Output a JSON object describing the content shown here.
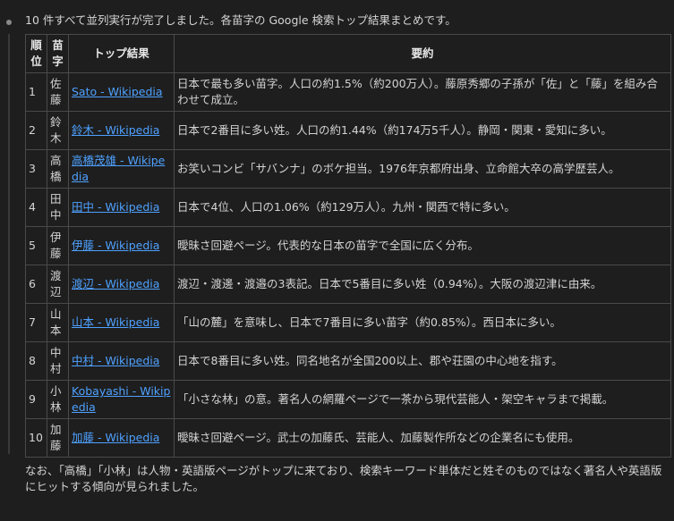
{
  "intro": "10 件すべて並列実行が完了しました。各苗字の Google 検索トップ結果まとめです。",
  "table": {
    "headers": [
      "順位",
      "苗字",
      "トップ結果",
      "要約"
    ],
    "rows": [
      {
        "rank": "1",
        "surname": "佐藤",
        "result": "Sato - Wikipedia",
        "summary": "日本で最も多い苗字。人口の約1.5%（約200万人）。藤原秀郷の子孫が「佐」と「藤」を組み合わせて成立。"
      },
      {
        "rank": "2",
        "surname": "鈴木",
        "result": "鈴木 - Wikipedia",
        "summary": "日本で2番目に多い姓。人口の約1.44%（約174万5千人）。静岡・関東・愛知に多い。"
      },
      {
        "rank": "3",
        "surname": "高橋",
        "result": "高橋茂雄 - Wikipedia",
        "summary": "お笑いコンビ「サバンナ」のボケ担当。1976年京都府出身、立命館大卒の高学歴芸人。"
      },
      {
        "rank": "4",
        "surname": "田中",
        "result": "田中 - Wikipedia",
        "summary": "日本で4位、人口の1.06%（約129万人）。九州・関西で特に多い。"
      },
      {
        "rank": "5",
        "surname": "伊藤",
        "result": "伊藤 - Wikipedia",
        "summary": "曖昧さ回避ページ。代表的な日本の苗字で全国に広く分布。"
      },
      {
        "rank": "6",
        "surname": "渡辺",
        "result": "渡辺 - Wikipedia",
        "summary": "渡辺・渡邊・渡邉の3表記。日本で5番目に多い姓（0.94%）。大阪の渡辺津に由来。"
      },
      {
        "rank": "7",
        "surname": "山本",
        "result": "山本 - Wikipedia",
        "summary": "「山の麓」を意味し、日本で7番目に多い苗字（約0.85%）。西日本に多い。"
      },
      {
        "rank": "8",
        "surname": "中村",
        "result": "中村 - Wikipedia",
        "summary": "日本で8番目に多い姓。同名地名が全国200以上、郡や荘園の中心地を指す。"
      },
      {
        "rank": "9",
        "surname": "小林",
        "result": "Kobayashi - Wikipedia",
        "summary": "「小さな林」の意。著名人の網羅ページで一茶から現代芸能人・架空キャラまで掲載。"
      },
      {
        "rank": "10",
        "surname": "加藤",
        "result": "加藤 - Wikipedia",
        "summary": "曖昧さ回避ページ。武士の加藤氏、芸能人、加藤製作所などの企業名にも使用。"
      }
    ]
  },
  "outro": "なお、「高橋」「小林」は人物・英語版ページがトップに来ており、検索キーワード単体だと姓そのものではなく著名人や英語版にヒットする傾向が見られました。"
}
